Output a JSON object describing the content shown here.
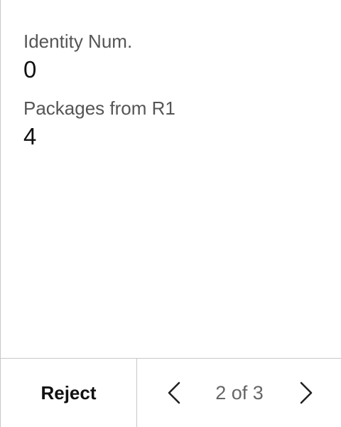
{
  "fields": [
    {
      "label": "Identity Num.",
      "value": "0"
    },
    {
      "label": "Packages from R1",
      "value": "4"
    }
  ],
  "footer": {
    "reject_label": "Reject",
    "pagination": {
      "text": "2 of 3"
    }
  },
  "icons": {
    "prev": "chevron-left-icon",
    "next": "chevron-right-icon"
  },
  "colors": {
    "label": "#555555",
    "value": "#111111",
    "divider": "#c8c8c8",
    "pager_text": "#666666"
  }
}
